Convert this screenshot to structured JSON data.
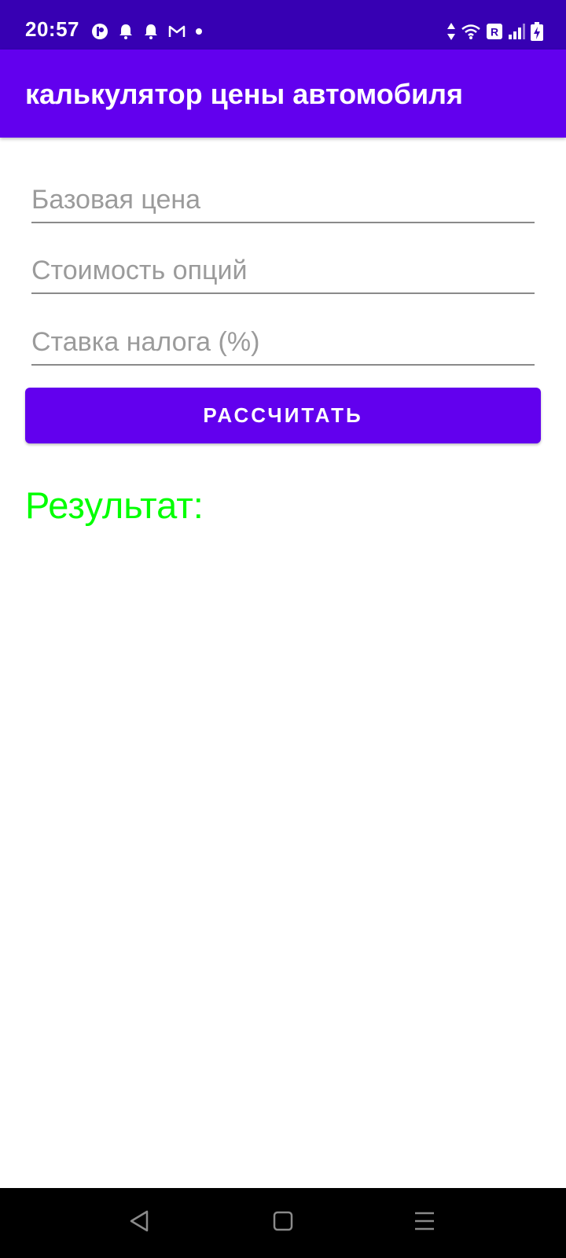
{
  "status_bar": {
    "time": "20:57",
    "left_icons": [
      "app-notification-icon",
      "bell-icon",
      "bell-icon",
      "gmail-icon",
      "dot-icon"
    ],
    "right_icons": [
      "data-arrows-icon",
      "wifi-icon",
      "roaming-icon",
      "signal-icon",
      "battery-charging-icon"
    ],
    "roaming_label": "R",
    "background_color": "#3700b3"
  },
  "app_bar": {
    "title": "калькулятор цены автомобиля",
    "background_color": "#6200ee"
  },
  "form": {
    "base_price": {
      "value": "",
      "placeholder": "Базовая цена"
    },
    "options_cost": {
      "value": "",
      "placeholder": "Стоимость опций"
    },
    "tax_rate": {
      "value": "",
      "placeholder": "Ставка налога (%)"
    },
    "calculate_label": "РАССЧИТАТЬ"
  },
  "result": {
    "label": "Результат:",
    "color": "#00ff00"
  },
  "nav_bar": {
    "buttons": [
      "back-icon",
      "home-icon",
      "menu-icon"
    ]
  }
}
